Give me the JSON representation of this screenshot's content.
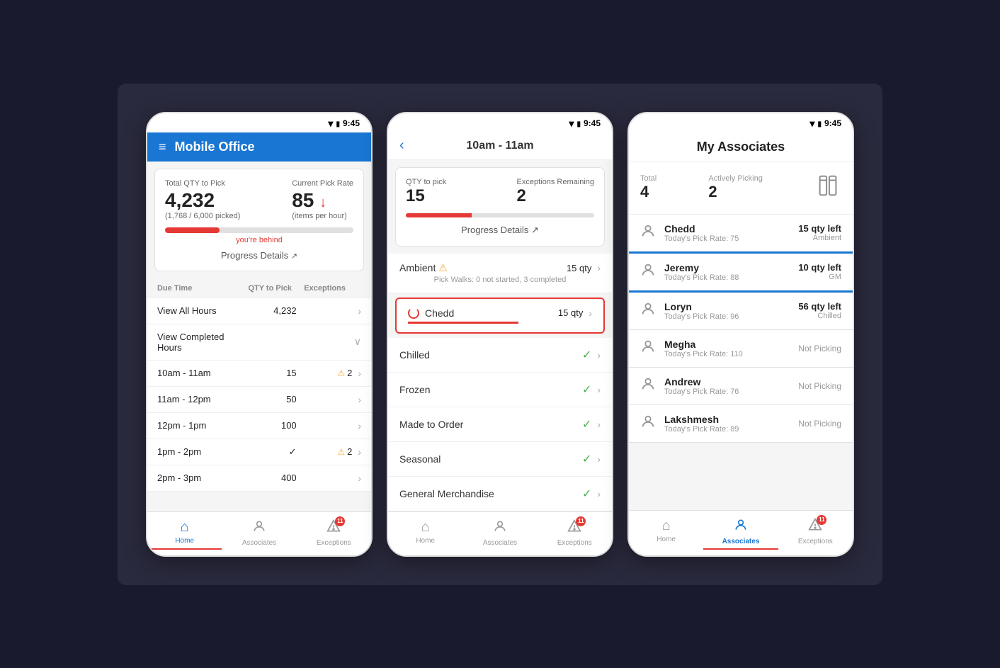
{
  "phone1": {
    "statusBar": {
      "time": "9:45"
    },
    "header": {
      "title": "Mobile Office",
      "menuIcon": "≡"
    },
    "summary": {
      "totalQtyLabel": "Total QTY to Pick",
      "totalQty": "4,232",
      "totalQtySub": "(1,768 / 6,000 picked)",
      "pickRateLabel": "Current Pick Rate",
      "pickRate": "85",
      "pickRateArrow": "↓",
      "pickRateSub": "(items per hour)",
      "behindText": "you're behind",
      "progressLink": "Progress Details"
    },
    "tableHeader": {
      "dueTime": "Due Time",
      "qtyToPick": "QTY to Pick",
      "exceptions": "Exceptions"
    },
    "rows": [
      {
        "due": "View All Hours",
        "qty": "4,232",
        "exc": "",
        "chevron": true
      },
      {
        "due": "View Completed Hours",
        "qty": "",
        "exc": "",
        "chevron": true,
        "checkmark": true
      },
      {
        "due": "10am - 11am",
        "qty": "15",
        "exc": "2",
        "warning": true,
        "chevron": true
      },
      {
        "due": "11am - 12pm",
        "qty": "50",
        "exc": "",
        "chevron": true
      },
      {
        "due": "12pm - 1pm",
        "qty": "100",
        "exc": "",
        "chevron": true
      },
      {
        "due": "1pm - 2pm",
        "qty": "",
        "exc": "2",
        "warning": true,
        "checkmark": true,
        "chevron": true
      },
      {
        "due": "2pm - 3pm",
        "qty": "400",
        "exc": "",
        "chevron": true
      }
    ],
    "bottomNav": [
      {
        "label": "Home",
        "icon": "⌂",
        "active": true
      },
      {
        "label": "Associates",
        "icon": "👤"
      },
      {
        "label": "Exceptions",
        "icon": "⚠",
        "badge": "11"
      }
    ]
  },
  "phone2": {
    "statusBar": {
      "time": "9:45"
    },
    "header": {
      "title": "10am - 11am",
      "backIcon": "<"
    },
    "hourCard": {
      "qtyLabel": "QTY to pick",
      "qtyValue": "15",
      "exceptionsLabel": "Exceptions Remaining",
      "exceptionsValue": "2",
      "progressLink": "Progress Details"
    },
    "categories": [
      {
        "name": "Ambient",
        "qty": "15 qty",
        "warning": true,
        "sub": "Pick Walks: 0 not started, 3 completed",
        "chevron": true
      },
      {
        "name": "Chedd",
        "qty": "15 qty",
        "loading": true,
        "chevron": true
      },
      {
        "name": "Chilled",
        "qty": "",
        "check": true,
        "chevron": true
      },
      {
        "name": "Frozen",
        "qty": "",
        "check": true,
        "chevron": true
      },
      {
        "name": "Made to Order",
        "qty": "",
        "check": true,
        "chevron": true
      },
      {
        "name": "Seasonal",
        "qty": "",
        "check": true,
        "chevron": true
      },
      {
        "name": "General Merchandise",
        "qty": "",
        "check": true,
        "chevron": true
      }
    ],
    "bottomNav": [
      {
        "label": "Home",
        "icon": "⌂"
      },
      {
        "label": "Associates",
        "icon": "👤"
      },
      {
        "label": "Exceptions",
        "icon": "⚠",
        "badge": "11"
      }
    ]
  },
  "phone3": {
    "statusBar": {
      "time": "9:45"
    },
    "header": {
      "title": "My Associates"
    },
    "total": {
      "totalLabel": "Total",
      "totalValue": "4",
      "pickingLabel": "Actively Picking",
      "pickingValue": "2"
    },
    "associates": [
      {
        "name": "Chedd",
        "rate": "Today's Pick Rate: 75",
        "qty": "15 qty left",
        "dept": "Ambient"
      },
      {
        "name": "Jeremy",
        "rate": "Today's Pick Rate: 88",
        "qty": "10 qty left",
        "dept": "GM"
      },
      {
        "name": "Loryn",
        "rate": "Today's Pick Rate: 96",
        "qty": "56 qty left",
        "dept": "Chilled"
      },
      {
        "name": "Megha",
        "rate": "Today's Pick Rate: 110",
        "qty": "",
        "dept": "",
        "notPicking": "Not Picking"
      },
      {
        "name": "Andrew",
        "rate": "Today's Pick Rate: 76",
        "qty": "",
        "dept": "",
        "notPicking": "Not Picking"
      },
      {
        "name": "Lakshmesh",
        "rate": "Today's Pick Rate: 89",
        "qty": "",
        "dept": "",
        "notPicking": "Not Picking"
      }
    ],
    "bottomNav": [
      {
        "label": "Home",
        "icon": "⌂"
      },
      {
        "label": "Associates",
        "icon": "👤",
        "active": true
      },
      {
        "label": "Exceptions",
        "icon": "⚠",
        "badge": "11"
      }
    ]
  }
}
